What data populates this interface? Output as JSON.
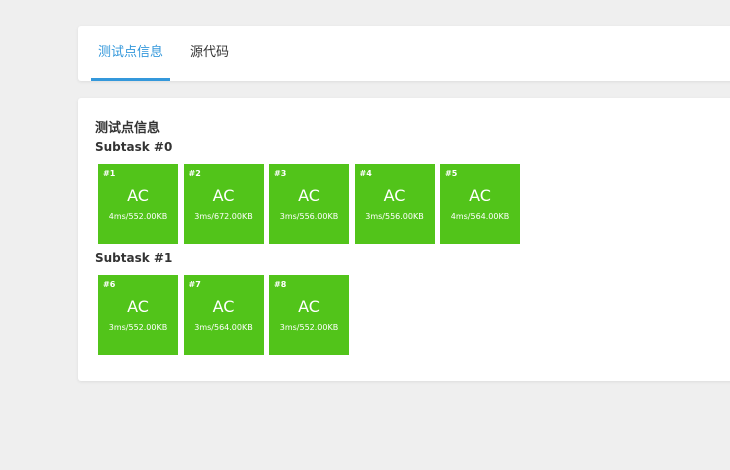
{
  "tabs": [
    {
      "label": "测试点信息",
      "active": true
    },
    {
      "label": "源代码",
      "active": false
    }
  ],
  "section_title": "测试点信息",
  "colors": {
    "accepted": "#52c41a",
    "tab_active": "#3498db",
    "background": "#efefef"
  },
  "subtasks": [
    {
      "title": "Subtask #0",
      "cases": [
        {
          "num": "#1",
          "status": "AC",
          "info": "4ms/552.00KB"
        },
        {
          "num": "#2",
          "status": "AC",
          "info": "3ms/672.00KB"
        },
        {
          "num": "#3",
          "status": "AC",
          "info": "3ms/556.00KB"
        },
        {
          "num": "#4",
          "status": "AC",
          "info": "3ms/556.00KB"
        },
        {
          "num": "#5",
          "status": "AC",
          "info": "4ms/564.00KB"
        }
      ]
    },
    {
      "title": "Subtask #1",
      "cases": [
        {
          "num": "#6",
          "status": "AC",
          "info": "3ms/552.00KB"
        },
        {
          "num": "#7",
          "status": "AC",
          "info": "3ms/564.00KB"
        },
        {
          "num": "#8",
          "status": "AC",
          "info": "3ms/552.00KB"
        }
      ]
    }
  ]
}
